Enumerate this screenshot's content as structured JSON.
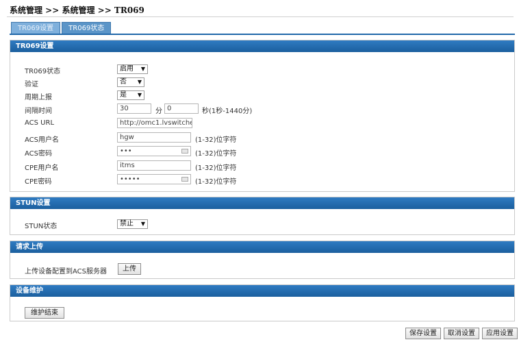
{
  "breadcrumb": "系统管理 >> 系统管理 >> TR069",
  "tabs": [
    {
      "label": "TR069设置"
    },
    {
      "label": "TR069状态"
    }
  ],
  "tr069": {
    "title": "TR069设置",
    "status_label": "TR069状态",
    "status_value": "启用",
    "auth_label": "验证",
    "auth_value": "否",
    "periodic_label": "周期上报",
    "periodic_value": "是",
    "interval_label": "间隔时间",
    "interval_min": "30",
    "interval_min_unit": "分",
    "interval_sec": "0",
    "interval_note": "秒(1秒-1440分)",
    "acs_url_label": "ACS URL",
    "acs_url_value": "http://omc1.lvswitche",
    "acs_user_label": "ACS用户名",
    "acs_user_value": "hgw",
    "acs_user_note": "(1-32)位字符",
    "acs_pwd_label": "ACS密码",
    "acs_pwd_value": "•••",
    "acs_pwd_note": "(1-32)位字符",
    "cpe_user_label": "CPE用户名",
    "cpe_user_value": "itms",
    "cpe_user_note": "(1-32)位字符",
    "cpe_pwd_label": "CPE密码",
    "cpe_pwd_value": "•••••",
    "cpe_pwd_note": "(1-32)位字符"
  },
  "stun": {
    "title": "STUN设置",
    "status_label": "STUN状态",
    "status_value": "禁止"
  },
  "upload": {
    "title": "请求上传",
    "label": "上传设备配置到ACS服务器",
    "button": "上传"
  },
  "maintenance": {
    "title": "设备维护",
    "button": "维护结束"
  },
  "footer": {
    "save": "保存设置",
    "cancel": "取消设置",
    "apply": "应用设置"
  },
  "colors": {
    "panel_header": "#1b5f9e",
    "tab": "#5b95c8"
  }
}
